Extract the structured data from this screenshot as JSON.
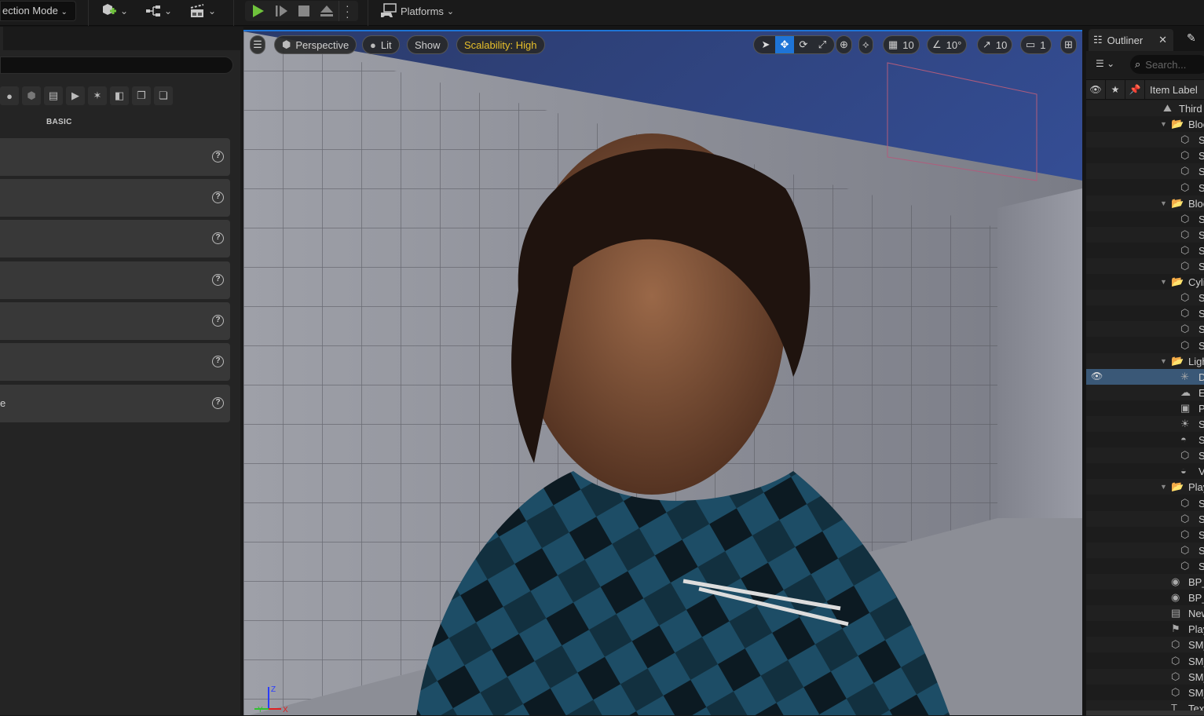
{
  "toolbar": {
    "mode_label": "ection Mode",
    "add_content_icon": "add-actor-icon",
    "blueprint_icon": "blueprint-icon",
    "cinematics_icon": "clapboard-icon",
    "play_icon": "play-icon",
    "platforms_label": "Platforms"
  },
  "place_actors": {
    "category_label": "BASIC",
    "category_icons": [
      "lightbulb-icon",
      "cube-icon",
      "clapboard-icon",
      "media-icon",
      "effects-icon",
      "shapes-icon",
      "volume-icon",
      "all-classes-icon"
    ],
    "rows": [
      {
        "label": ""
      },
      {
        "label": ""
      },
      {
        "label": ""
      },
      {
        "label": ""
      },
      {
        "label": ""
      },
      {
        "label": ""
      },
      {
        "label": "e"
      }
    ]
  },
  "viewport": {
    "menu_icon": "hamburger-icon",
    "view_mode": "Perspective",
    "lighting_mode": "Lit",
    "show_label": "Show",
    "scalability": "Scalability: High",
    "scalability_color": "#e8c02a",
    "grid_snap": "10",
    "rotation_snap": "10°",
    "scale_snap": "10",
    "camera_speed": "1",
    "accent": "#1e74d6",
    "axis": {
      "x": "X",
      "y": "Y",
      "z": "Z"
    }
  },
  "outliner": {
    "tab_label": "Outliner",
    "search_placeholder": "Search...",
    "column_label": "Item Label",
    "rows": [
      {
        "text": "Third",
        "icon": "level",
        "depth": 0,
        "folder": false
      },
      {
        "text": "Bloc",
        "icon": "folder",
        "depth": 1,
        "folder": true
      },
      {
        "text": "S",
        "icon": "mesh",
        "depth": 2
      },
      {
        "text": "S",
        "icon": "mesh",
        "depth": 2
      },
      {
        "text": "S",
        "icon": "mesh",
        "depth": 2
      },
      {
        "text": "S",
        "icon": "mesh",
        "depth": 2
      },
      {
        "text": "Bloc",
        "icon": "folder",
        "depth": 1,
        "folder": true,
        "expanded": true
      },
      {
        "text": "S",
        "icon": "mesh",
        "depth": 2
      },
      {
        "text": "S",
        "icon": "mesh",
        "depth": 2
      },
      {
        "text": "S",
        "icon": "mesh",
        "depth": 2
      },
      {
        "text": "S",
        "icon": "mesh",
        "depth": 2
      },
      {
        "text": "Cyli",
        "icon": "folder",
        "depth": 1,
        "folder": true,
        "expanded": true
      },
      {
        "text": "S",
        "icon": "mesh",
        "depth": 2
      },
      {
        "text": "S",
        "icon": "mesh",
        "depth": 2
      },
      {
        "text": "S",
        "icon": "mesh",
        "depth": 2
      },
      {
        "text": "S",
        "icon": "mesh",
        "depth": 2
      },
      {
        "text": "Ligh",
        "icon": "folder",
        "depth": 1,
        "folder": true,
        "expanded": true
      },
      {
        "text": "D",
        "icon": "directional-light",
        "depth": 2,
        "selected": true
      },
      {
        "text": "E",
        "icon": "fog",
        "depth": 2
      },
      {
        "text": "P",
        "icon": "post-process",
        "depth": 2
      },
      {
        "text": "S",
        "icon": "sky-atmosphere",
        "depth": 2
      },
      {
        "text": "S",
        "icon": "sky-light",
        "depth": 2
      },
      {
        "text": "S",
        "icon": "mesh",
        "depth": 2
      },
      {
        "text": "V",
        "icon": "volumetric-cloud",
        "depth": 2
      },
      {
        "text": "Play",
        "icon": "folder",
        "depth": 1,
        "folder": true,
        "expanded": true
      },
      {
        "text": "S",
        "icon": "mesh",
        "depth": 2
      },
      {
        "text": "S",
        "icon": "mesh",
        "depth": 2
      },
      {
        "text": "S",
        "icon": "mesh",
        "depth": 2
      },
      {
        "text": "S",
        "icon": "mesh",
        "depth": 2
      },
      {
        "text": "S",
        "icon": "mesh",
        "depth": 2
      },
      {
        "text": "BP_",
        "icon": "blueprint-actor",
        "depth": 1
      },
      {
        "text": "BP_",
        "icon": "blueprint-actor",
        "depth": 1
      },
      {
        "text": "New",
        "icon": "level-sequence",
        "depth": 1
      },
      {
        "text": "Play",
        "icon": "player-start",
        "depth": 1
      },
      {
        "text": "SM_",
        "icon": "mesh",
        "depth": 1
      },
      {
        "text": "SM_",
        "icon": "mesh",
        "depth": 1
      },
      {
        "text": "SM_",
        "icon": "mesh",
        "depth": 1
      },
      {
        "text": "SM_",
        "icon": "mesh",
        "depth": 1
      },
      {
        "text": "Tex",
        "icon": "text-render",
        "depth": 1
      }
    ]
  }
}
